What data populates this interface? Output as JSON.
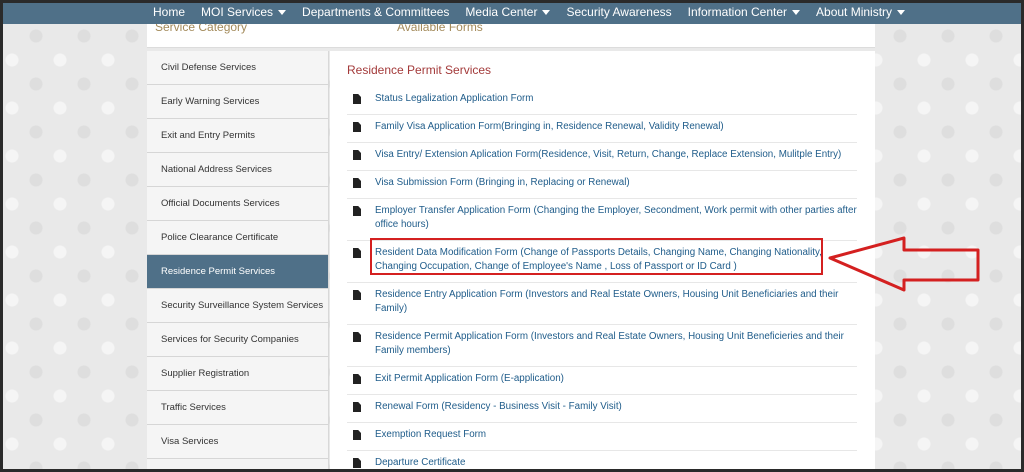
{
  "nav": {
    "items": [
      {
        "label": "Home",
        "dropdown": false
      },
      {
        "label": "MOI Services",
        "dropdown": true
      },
      {
        "label": "Departments & Committees",
        "dropdown": false
      },
      {
        "label": "Media Center",
        "dropdown": true
      },
      {
        "label": "Security Awareness",
        "dropdown": false
      },
      {
        "label": "Information Center",
        "dropdown": true
      },
      {
        "label": "About Ministry",
        "dropdown": true
      }
    ]
  },
  "header": {
    "service_category": "Service Category",
    "available_forms": "Available Forms"
  },
  "sidebar": {
    "items": [
      {
        "label": "Civil Defense Services",
        "active": false
      },
      {
        "label": "Early Warning Services",
        "active": false
      },
      {
        "label": "Exit and Entry Permits",
        "active": false
      },
      {
        "label": "National Address Services",
        "active": false
      },
      {
        "label": "Official Documents Services",
        "active": false
      },
      {
        "label": "Police Clearance Certificate",
        "active": false
      },
      {
        "label": "Residence Permit Services",
        "active": true
      },
      {
        "label": "Security Surveillance System Services",
        "active": false
      },
      {
        "label": "Services for Security Companies",
        "active": false
      },
      {
        "label": "Supplier Registration",
        "active": false
      },
      {
        "label": "Traffic Services",
        "active": false
      },
      {
        "label": "Visa Services",
        "active": false
      }
    ]
  },
  "main": {
    "title": "Residence Permit Services",
    "forms": [
      {
        "label": "Status Legalization Application Form"
      },
      {
        "label": "Family Visa Application Form(Bringing in, Residence Renewal, Validity Renewal)"
      },
      {
        "label": "Visa Entry/ Extension Aplication Form(Residence, Visit, Return, Change, Replace Extension, Mulitple Entry)"
      },
      {
        "label": "Visa Submission Form (Bringing in, Replacing or Renewal)"
      },
      {
        "label": "Employer Transfer Application Form (Changing the Employer, Secondment, Work permit with other parties after office hours)"
      },
      {
        "label": "Resident Data Modification Form (Change of Passports Details, Changing Name, Changing Nationality, Changing Occupation, Change of Employee's Name , Loss of Passport or ID Card )"
      },
      {
        "label": "Residence Entry Application Form (Investors and Real Estate Owners, Housing Unit Beneficiaries and their Family)"
      },
      {
        "label": "Residence Permit Application Form (Investors and Real Estate Owners, Housing Unit Beneficieries and their Family members)"
      },
      {
        "label": "Exit Permit Application Form (E-application)"
      },
      {
        "label": "Renewal Form (Residency - Business Visit - Family Visit)"
      },
      {
        "label": "Exemption Request Form"
      },
      {
        "label": "Departure Certificate"
      }
    ]
  },
  "annotation": {
    "highlight_color": "#d42020"
  },
  "colors": {
    "nav_bg": "#4f7088",
    "active_bg": "#4f7088",
    "link": "#1f5c8a",
    "title": "#a33a3a"
  }
}
